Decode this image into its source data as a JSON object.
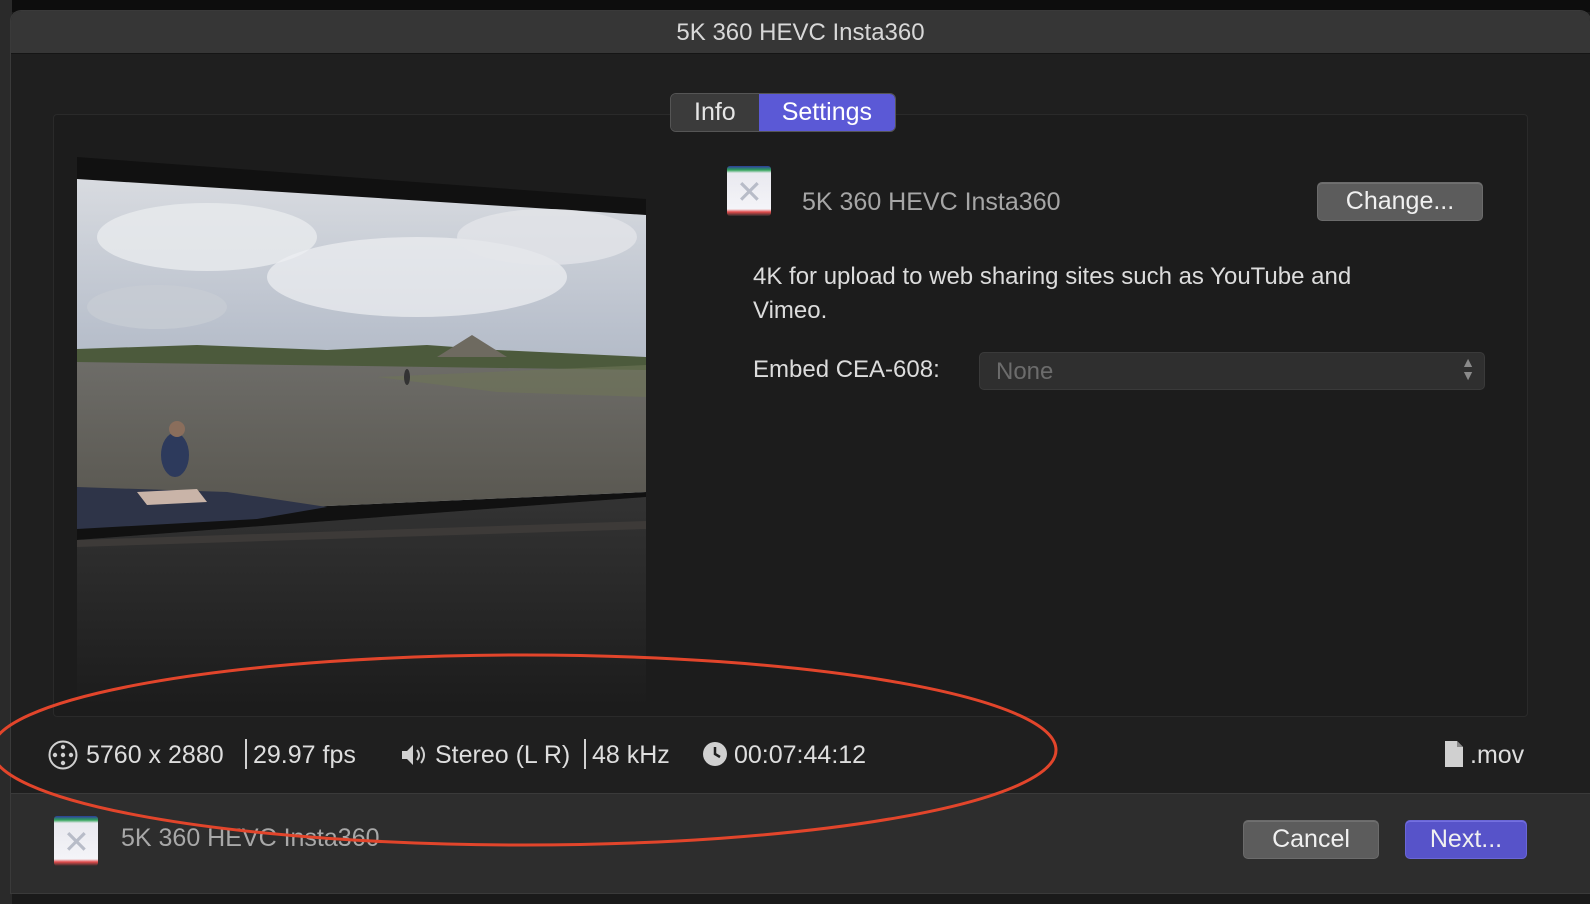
{
  "window": {
    "title": "5K 360 HEVC Insta360"
  },
  "tabs": [
    {
      "label": "Info",
      "active": false
    },
    {
      "label": "Settings",
      "active": true
    }
  ],
  "details": {
    "preset_name": "5K 360 HEVC Insta360",
    "change_button": "Change...",
    "description": "4K for upload to web sharing sites such as YouTube and Vimeo.",
    "embed_label": "Embed CEA-608:",
    "embed_value": "None"
  },
  "infobar": {
    "resolution": "5760 x 2880",
    "frame_rate": "29.97 fps",
    "audio_channels": "Stereo (L R)",
    "sample_rate": "48 kHz",
    "duration": "00:07:44:12",
    "file_extension": ".mov",
    "icons": [
      "vr-360-icon",
      "speaker-icon",
      "clock-icon",
      "document-icon"
    ]
  },
  "footer": {
    "preset_name": "5K 360 HEVC Insta360",
    "cancel_button": "Cancel",
    "next_button": "Next..."
  },
  "colors": {
    "accent": "#5b59d6",
    "annotation": "#e2452b",
    "background": "#1f1f1f"
  }
}
